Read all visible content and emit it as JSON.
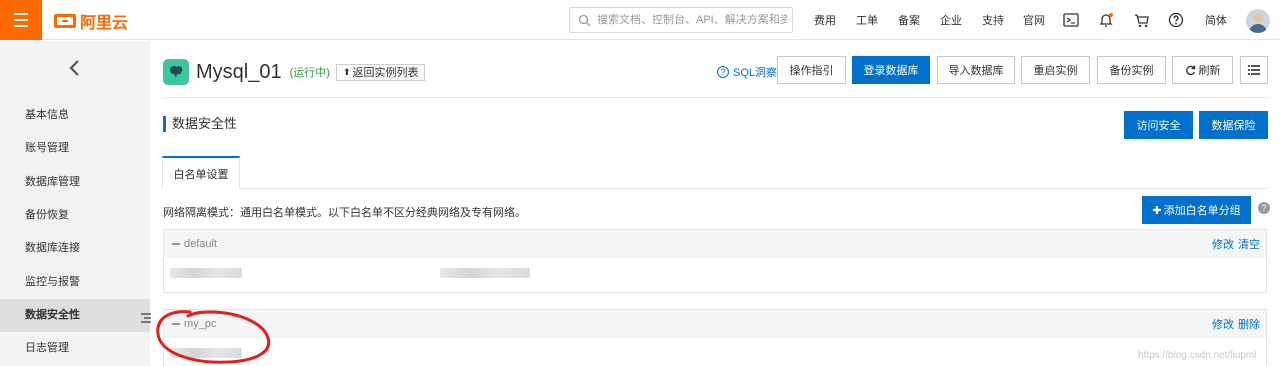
{
  "header": {
    "logo_text": "阿里云",
    "search": {
      "placeholder": "搜索文档、控制台、API、解决方案和资源"
    },
    "nav": [
      "费用",
      "工单",
      "备案",
      "企业",
      "支持",
      "官网"
    ],
    "lang": "简体"
  },
  "sidebar": {
    "items": [
      {
        "label": "基本信息"
      },
      {
        "label": "账号管理"
      },
      {
        "label": "数据库管理"
      },
      {
        "label": "备份恢复"
      },
      {
        "label": "数据库连接"
      },
      {
        "label": "监控与报警"
      },
      {
        "label": "数据安全性",
        "active": true
      },
      {
        "label": "日志管理"
      }
    ]
  },
  "instance": {
    "name": "Mysql_01",
    "status": "(运行中)",
    "back_label": "返回实例列表"
  },
  "toolbar": {
    "sql_insight": "SQL洞察",
    "buttons": [
      "操作指引",
      "登录数据库",
      "导入数据库",
      "重启实例",
      "备份实例"
    ],
    "refresh": "刷新"
  },
  "section": {
    "title": "数据安全性",
    "access_security": "访问安全",
    "data_insurance": "数据保险"
  },
  "tabs": {
    "whitelist": "白名单设置"
  },
  "whitelist": {
    "note": "网络隔离模式：通用白名单模式。以下白名单不区分经典网络及专有网络。",
    "add_button": "添加白名单分组",
    "groups": [
      {
        "name": "default",
        "edit": "修改",
        "action2": "清空"
      },
      {
        "name": "my_pc",
        "edit": "修改",
        "action2": "删除"
      }
    ]
  },
  "watermark": "https://blog.csdn.net/liupml",
  "colors": {
    "brand": "#ff6a00",
    "primary": "#0070cc",
    "running": "#2a9d3a"
  }
}
